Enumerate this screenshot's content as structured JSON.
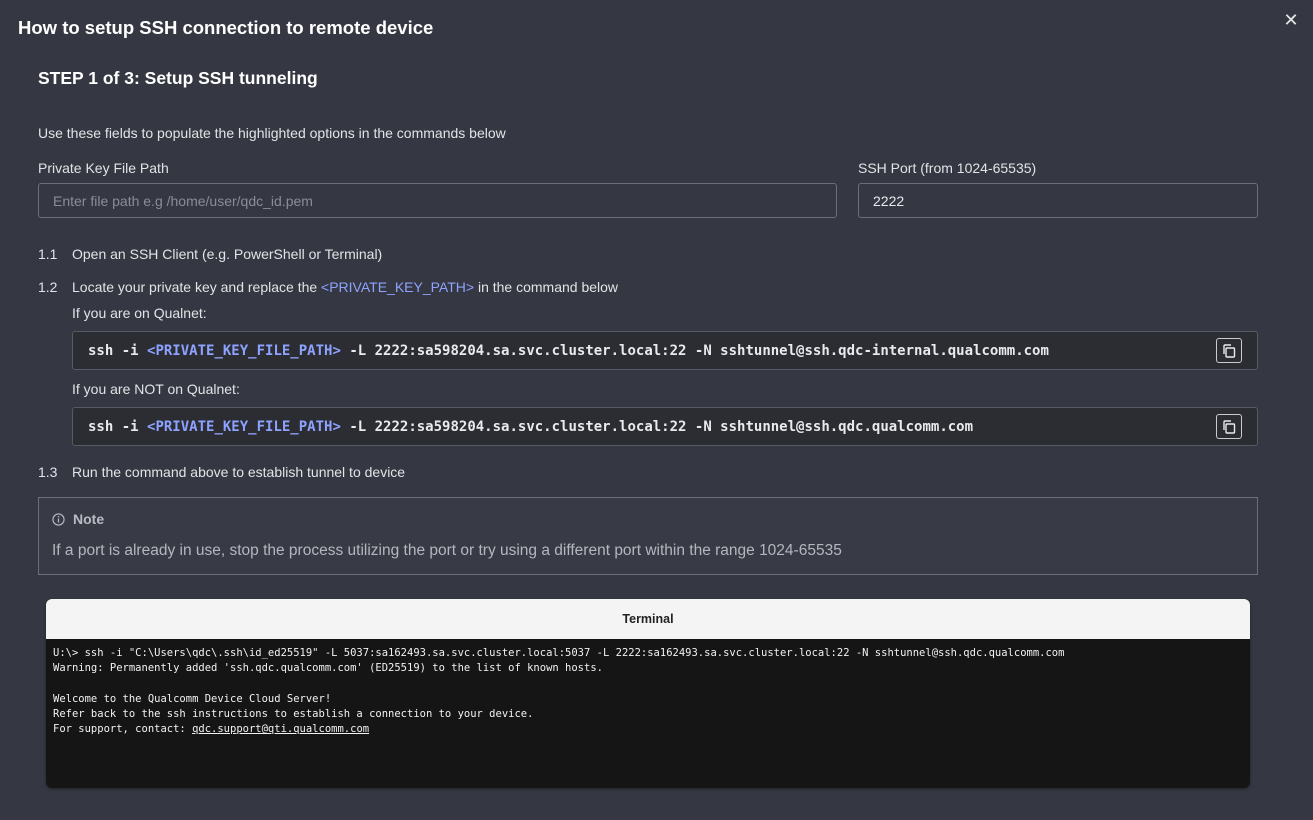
{
  "dialog": {
    "title": "How to setup SSH connection to remote device",
    "close_glyph": "✕"
  },
  "step": {
    "title": "STEP 1 of 3: Setup SSH tunneling",
    "intro": "Use these fields to populate the highlighted options in the commands below"
  },
  "fields": {
    "key_path": {
      "label": "Private Key File Path",
      "placeholder": "Enter file path e.g /home/user/qdc_id.pem",
      "value": ""
    },
    "ssh_port": {
      "label": "SSH Port (from 1024-65535)",
      "value": "2222"
    }
  },
  "steps": {
    "s1": {
      "num": "1.1",
      "text": "Open an SSH Client (e.g. PowerShell or Terminal)"
    },
    "s2": {
      "num": "1.2",
      "text_before": "Locate your private key and replace the ",
      "highlight": "<PRIVATE_KEY_PATH>",
      "text_after": " in the command below"
    },
    "s3": {
      "num": "1.3",
      "text": "Run the command above to establish tunnel to device"
    }
  },
  "commands": {
    "qualnet": {
      "label": "If you are on Qualnet:",
      "prefix": "ssh -i ",
      "placeholder": "<PRIVATE_KEY_FILE_PATH>",
      "suffix": " -L 2222:sa598204.sa.svc.cluster.local:22 -N sshtunnel@ssh.qdc-internal.qualcomm.com"
    },
    "non_qualnet": {
      "label": "If you are NOT on Qualnet:",
      "prefix": "ssh -i ",
      "placeholder": "<PRIVATE_KEY_FILE_PATH>",
      "suffix": " -L 2222:sa598204.sa.svc.cluster.local:22 -N sshtunnel@ssh.qdc.qualcomm.com"
    }
  },
  "note": {
    "title": "Note",
    "text": "If a port is already in use, stop the process utilizing the port or try using a different port within the range 1024-65535"
  },
  "terminal": {
    "title": "Terminal",
    "line1": "U:\\> ssh -i \"C:\\Users\\qdc\\.ssh\\id_ed25519\" -L 5037:sa162493.sa.svc.cluster.local:5037 -L 2222:sa162493.sa.svc.cluster.local:22 -N sshtunnel@ssh.qdc.qualcomm.com",
    "line2": "Warning: Permanently added 'ssh.qdc.qualcomm.com' (ED25519) to the list of known hosts.",
    "line3": "",
    "line4": "Welcome to the Qualcomm Device Cloud Server!",
    "line5": "Refer back to the ssh instructions to establish a connection to your device.",
    "line6_prefix": "For support, contact: ",
    "support_email": "qdc.support@qti.qualcomm.com"
  }
}
